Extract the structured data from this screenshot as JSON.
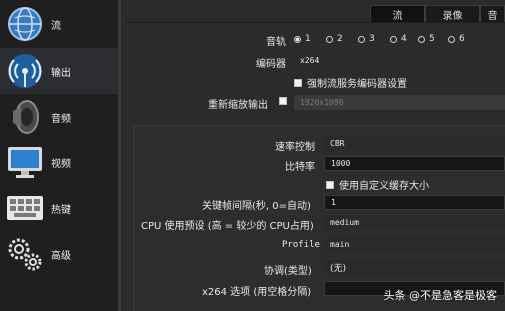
{
  "sidebar": {
    "items": [
      {
        "label": "流",
        "icon": "globe-icon"
      },
      {
        "label": "输出",
        "icon": "broadcast-icon"
      },
      {
        "label": "音频",
        "icon": "speaker-icon"
      },
      {
        "label": "视频",
        "icon": "monitor-icon"
      },
      {
        "label": "热键",
        "icon": "keyboard-icon"
      },
      {
        "label": "高级",
        "icon": "gears-icon"
      }
    ],
    "selected": "输出"
  },
  "tabs": [
    {
      "label": "流",
      "active": true
    },
    {
      "label": "录像",
      "active": false
    },
    {
      "label": "音",
      "active": false
    }
  ],
  "audio_track": {
    "label": "音轨",
    "options": [
      "1",
      "2",
      "3",
      "4",
      "5",
      "6"
    ],
    "selected": "1"
  },
  "encoder": {
    "label": "编码器",
    "value": "x264"
  },
  "enforce_stream_encoder": {
    "label": "强制流服务编码器设置",
    "checked": false
  },
  "rescale_output": {
    "label": "重新缩放输出",
    "value": "1920x1080",
    "checked": false
  },
  "rate_control": {
    "label": "速率控制",
    "value": "CBR"
  },
  "bitrate": {
    "label": "比特率",
    "value": "1000"
  },
  "custom_buffer": {
    "label": "使用自定义缓存大小",
    "checked": false
  },
  "keyframe_interval": {
    "label": "关键帧间隔(秒, 0=自动)",
    "value": "1"
  },
  "cpu_preset": {
    "label": "CPU 使用预设 (高 = 较少的 CPU占用)",
    "value": "medium"
  },
  "profile": {
    "label": "Profile",
    "value": "main"
  },
  "tune": {
    "label": "协调(类型)",
    "value": "(无)"
  },
  "x264_options": {
    "label": "x264 选项 (用空格分隔)",
    "value": ""
  },
  "watermark": "头条 @不是急客是极客",
  "colors": {
    "background": "#2b2b2b",
    "sidebar": "#1f1f1f",
    "selected": "#2c2c33"
  }
}
